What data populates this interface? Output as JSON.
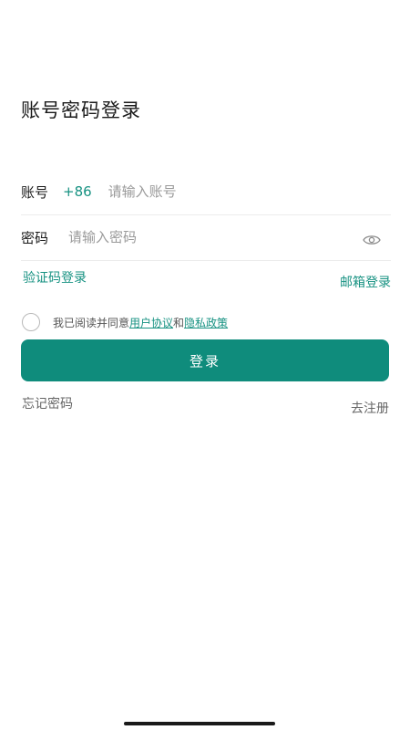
{
  "page": {
    "title": "账号密码登录"
  },
  "account": {
    "label": "账号",
    "country_code": "+86",
    "placeholder": "请输入账号",
    "value": ""
  },
  "password": {
    "label": "密码",
    "placeholder": "请输入密码",
    "value": "",
    "toggle_icon": "eye-icon"
  },
  "links": {
    "sms_login": "验证码登录",
    "email_login": "邮箱登录"
  },
  "agreement": {
    "checked": false,
    "prefix": "我已阅读并同意",
    "user_agreement": "用户协议",
    "conjunction": "和",
    "privacy_policy": "隐私政策"
  },
  "login_button": {
    "label": "登录"
  },
  "footer": {
    "forgot_password": "忘记密码",
    "register": "去注册"
  },
  "colors": {
    "accent": "#179282",
    "button": "#0f8c7c"
  }
}
